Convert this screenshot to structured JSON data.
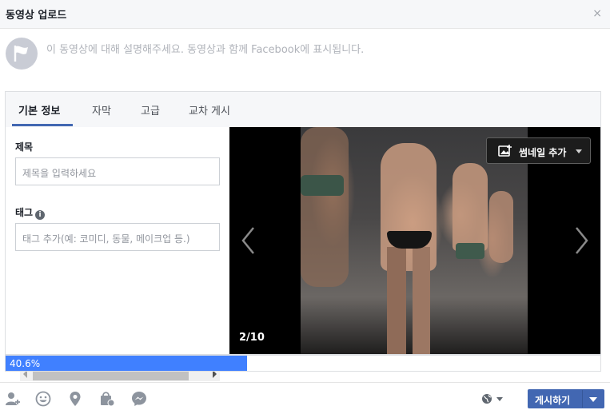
{
  "dialog": {
    "title": "동영상 업로드",
    "close_label": "×"
  },
  "composer": {
    "description_placeholder": "이 동영상에 대해 설명해주세요. 동영상과 함께 Facebook에 표시됩니다."
  },
  "tabs": [
    {
      "label": "기본 정보",
      "active": true
    },
    {
      "label": "자막",
      "active": false
    },
    {
      "label": "고급",
      "active": false
    },
    {
      "label": "교차 게시",
      "active": false
    }
  ],
  "form": {
    "title_label": "제목",
    "title_placeholder": "제목을 입력하세요",
    "tags_label": "태그",
    "tags_info_icon": "i",
    "tags_placeholder": "태그 추가(예: 코미디, 동물, 메이크업 등.)"
  },
  "preview": {
    "counter": "2/10",
    "thumbnail_button_label": "썸네일 추가"
  },
  "upload": {
    "progress_label": "40.6%",
    "progress_value": 40.6
  },
  "footer": {
    "icons": [
      "tag-friends-icon",
      "feeling-icon",
      "location-icon",
      "shop-icon",
      "messenger-icon"
    ],
    "audience_icon": "globe-icon",
    "post_label": "게시하기"
  },
  "colors": {
    "accent": "#4267b2",
    "progress": "#4080ff"
  }
}
